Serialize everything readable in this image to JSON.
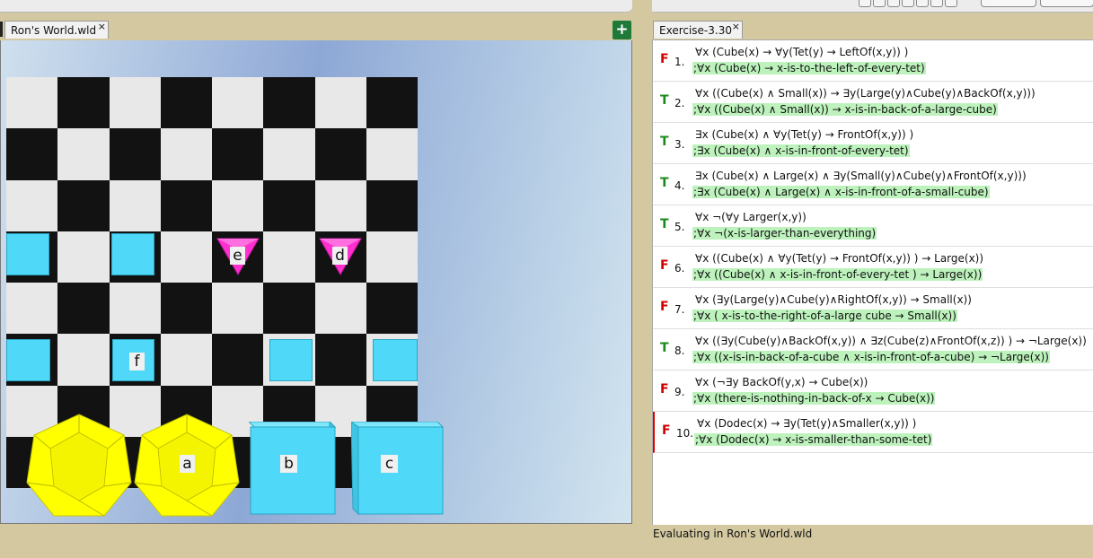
{
  "world_tab": {
    "label": "Ron's World.wld",
    "close": "×"
  },
  "exercise_tab": {
    "label": "Exercise-3.30",
    "close": "×"
  },
  "add_button": "+",
  "objects": {
    "tet_e": "e",
    "tet_d": "d",
    "cube_f": "f",
    "dodec_a": "a",
    "cube_b": "b",
    "cube_c": "c"
  },
  "sentences": [
    {
      "value": "F",
      "num": "1.",
      "formula": "∀x (Cube(x) → ∀y(Tet(y) → LeftOf(x,y)) )",
      "comment": ";∀x (Cube(x) → x-is-to-the-left-of-every-tet)"
    },
    {
      "value": "T",
      "num": "2.",
      "formula": "∀x ((Cube(x) ∧ Small(x)) → ∃y(Large(y)∧Cube(y)∧BackOf(x,y)))",
      "comment": ";∀x ((Cube(x) ∧ Small(x)) → x-is-in-back-of-a-large-cube)"
    },
    {
      "value": "T",
      "num": "3.",
      "formula": "∃x (Cube(x) ∧ ∀y(Tet(y) → FrontOf(x,y)) )",
      "comment": ";∃x (Cube(x) ∧ x-is-in-front-of-every-tet)"
    },
    {
      "value": "T",
      "num": "4.",
      "formula": "∃x (Cube(x) ∧ Large(x) ∧  ∃y(Small(y)∧Cube(y)∧FrontOf(x,y)))",
      "comment": ";∃x (Cube(x) ∧ Large(x) ∧ x-is-in-front-of-a-small-cube)"
    },
    {
      "value": "T",
      "num": "5.",
      "formula": "∀x ¬(∀y Larger(x,y))",
      "comment": ";∀x ¬(x-is-larger-than-everything)"
    },
    {
      "value": "F",
      "num": "6.",
      "formula": "∀x ((Cube(x) ∧ ∀y(Tet(y) → FrontOf(x,y)) ) → Large(x))",
      "comment": ";∀x ((Cube(x) ∧  x-is-in-front-of-every-tet ) → Large(x))"
    },
    {
      "value": "F",
      "num": "7.",
      "formula": "∀x (∃y(Large(y)∧Cube(y)∧RightOf(x,y))  → Small(x))",
      "comment": ";∀x ( x-is-to-the-right-of-a-large cube → Small(x))"
    },
    {
      "value": "T",
      "num": "8.",
      "formula": "∀x ((∃y(Cube(y)∧BackOf(x,y)) ∧ ∃z(Cube(z)∧FrontOf(x,z)) ) → ¬Large(x))",
      "comment": ";∀x ((x-is-in-back-of-a-cube ∧ x-is-in-front-of-a-cube) → ¬Large(x))"
    },
    {
      "value": "F",
      "num": "9.",
      "formula": "∀x (¬∃y BackOf(y,x) → Cube(x))",
      "comment": ";∀x (there-is-nothing-in-back-of-x → Cube(x))"
    },
    {
      "value": "F",
      "num": "10.",
      "formula": "∀x (Dodec(x) → ∃y(Tet(y)∧Smaller(x,y)) )",
      "comment": ";∀x (Dodec(x) → x-is-smaller-than-some-tet)"
    }
  ],
  "status": "Evaluating in Ron's World.wld",
  "colors": {
    "true": "#1a8a1a",
    "false": "#d00000",
    "cube": "#4fd8f7",
    "tet": "#ff2fd0",
    "dodec": "#ffff00",
    "comment_bg": "#bdf2bd"
  }
}
